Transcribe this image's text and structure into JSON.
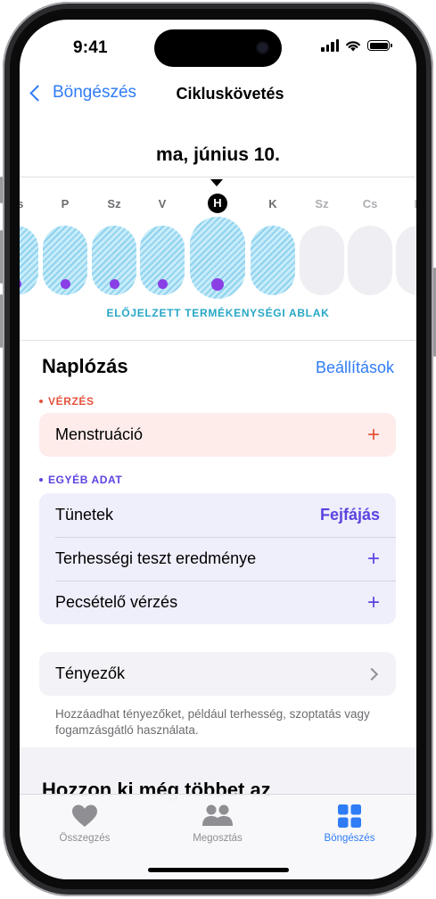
{
  "status": {
    "time": "9:41"
  },
  "nav": {
    "back_label": "Böngészés",
    "title": "Cikluskövetés"
  },
  "date_title": "ma, június 10.",
  "week": [
    {
      "letter": "Cs",
      "type": "hatch",
      "dot": true,
      "current": false
    },
    {
      "letter": "P",
      "type": "hatch",
      "dot": true,
      "current": false
    },
    {
      "letter": "Sz",
      "type": "hatch",
      "dot": true,
      "current": false
    },
    {
      "letter": "V",
      "type": "hatch",
      "dot": true,
      "current": false
    },
    {
      "letter": "H",
      "type": "hatch",
      "dot": true,
      "current": true
    },
    {
      "letter": "K",
      "type": "hatch",
      "dot": false,
      "current": false
    },
    {
      "letter": "Sz",
      "type": "empty",
      "dot": false,
      "current": false
    },
    {
      "letter": "Cs",
      "type": "empty",
      "dot": false,
      "current": false
    },
    {
      "letter": "P",
      "type": "empty",
      "dot": false,
      "current": false
    }
  ],
  "fertile_label": "ELŐJELZETT TERMÉKENYSÉGI ABLAK",
  "logging": {
    "title": "Naplózás",
    "settings_label": "Beállítások",
    "bleeding_label": "VÉRZÉS",
    "menstruation_label": "Menstruáció",
    "other_label": "EGYÉB ADAT",
    "symptoms_label": "Tünetek",
    "symptoms_value": "Fejfájás",
    "pregnancy_test_label": "Terhességi teszt eredménye",
    "spotting_label": "Pecsételő vérzés",
    "factors_label": "Tényezők",
    "factors_note": "Hozzáadhat tényezőket, például terhesség, szoptatás vagy fogamzásgátló használata."
  },
  "promo_title": "Hozzon ki még többet az",
  "tabs": [
    {
      "label": "Összegzés",
      "active": false
    },
    {
      "label": "Megosztás",
      "active": false
    },
    {
      "label": "Böngészés",
      "active": true
    }
  ],
  "colors": {
    "accent": "#2f7cf6",
    "bleeding": "#e5533d",
    "bleeding_bg": "#fdecea",
    "other": "#5b43e0",
    "other_bg": "#efeefb",
    "fertile": "#27a7c7",
    "dot": "#8a3ee6",
    "tab_inactive": "#8e8e93"
  }
}
